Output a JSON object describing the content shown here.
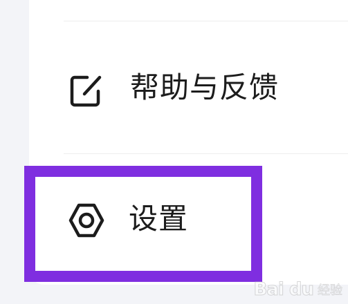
{
  "menu": {
    "items": [
      {
        "label": "帮助与反馈",
        "icon": "edit-square-icon"
      },
      {
        "label": "设置",
        "icon": "settings-hexagon-icon"
      }
    ]
  },
  "colors": {
    "highlight": "#7f2ee0",
    "text": "#1c1c1c",
    "background": "#f3f4f8"
  },
  "watermark": {
    "logo": "Bai du",
    "text": "经验"
  }
}
